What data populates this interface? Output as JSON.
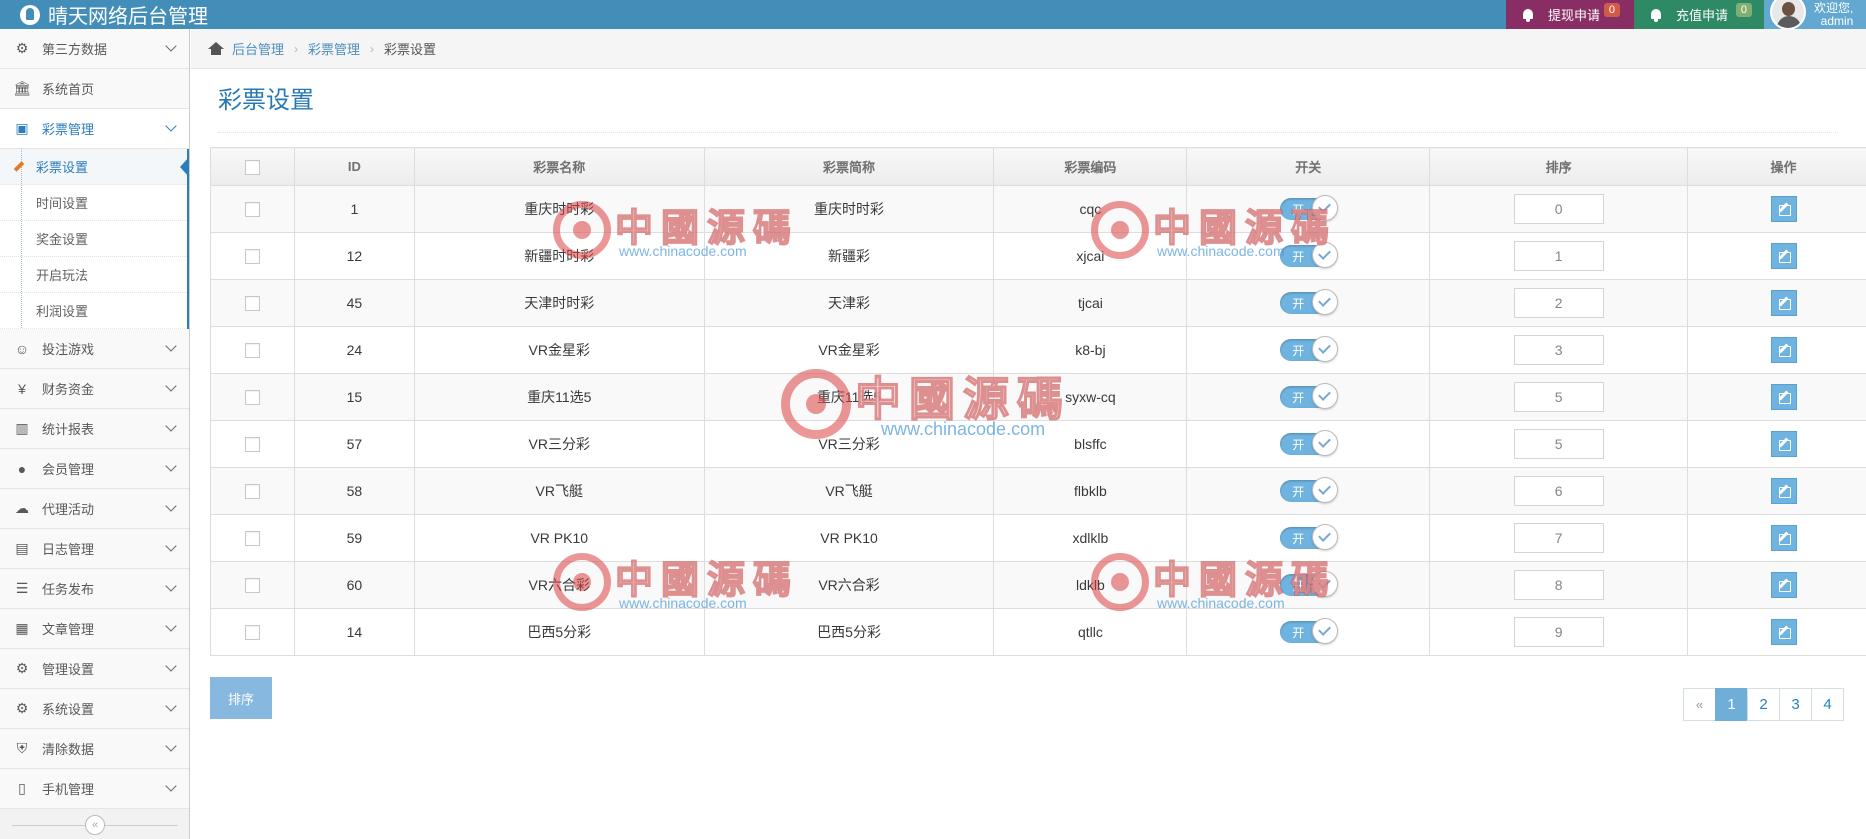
{
  "header": {
    "app_title": "晴天网络后台管理",
    "withdraw_label": "提现申请",
    "withdraw_count": "0",
    "recharge_label": "充值申请",
    "recharge_count": "0",
    "welcome": "欢迎您,",
    "username": "admin"
  },
  "sidebar": {
    "items": [
      {
        "label": "第三方数据",
        "icon": "gear-icon"
      },
      {
        "label": "系统首页",
        "icon": "bank-icon"
      },
      {
        "label": "彩票管理",
        "icon": "money-icon"
      },
      {
        "label": "投注游戏",
        "icon": "reddit-icon"
      },
      {
        "label": "财务资金",
        "icon": "yen-icon"
      },
      {
        "label": "统计报表",
        "icon": "bar-chart-icon"
      },
      {
        "label": "会员管理",
        "icon": "users-icon"
      },
      {
        "label": "代理活动",
        "icon": "cloud-icon"
      },
      {
        "label": "日志管理",
        "icon": "file-icon"
      },
      {
        "label": "任务发布",
        "icon": "tasks-icon"
      },
      {
        "label": "文章管理",
        "icon": "document-icon"
      },
      {
        "label": "管理设置",
        "icon": "gear-icon"
      },
      {
        "label": "系统设置",
        "icon": "gears-icon"
      },
      {
        "label": "清除数据",
        "icon": "shield-icon"
      },
      {
        "label": "手机管理",
        "icon": "mobile-icon"
      }
    ],
    "submenu": [
      "彩票设置",
      "时间设置",
      "奖金设置",
      "开启玩法",
      "利润设置"
    ],
    "collapse_glyph": "«"
  },
  "breadcrumb": {
    "home": "后台管理",
    "section": "彩票管理",
    "current": "彩票设置",
    "sep": "›"
  },
  "page": {
    "title": "彩票设置",
    "sort_button": "排序"
  },
  "table": {
    "headers": [
      "ID",
      "彩票名称",
      "彩票简称",
      "彩票编码",
      "开关",
      "排序",
      "操作"
    ],
    "toggle_label": "开",
    "rows": [
      {
        "id": "1",
        "name": "重庆时时彩",
        "short": "重庆时时彩",
        "code": "cqc",
        "sort": "0"
      },
      {
        "id": "12",
        "name": "新疆时时彩",
        "short": "新疆彩",
        "code": "xjcai",
        "sort": "1"
      },
      {
        "id": "45",
        "name": "天津时时彩",
        "short": "天津彩",
        "code": "tjcai",
        "sort": "2"
      },
      {
        "id": "24",
        "name": "VR金星彩",
        "short": "VR金星彩",
        "code": "k8-bj",
        "sort": "3"
      },
      {
        "id": "15",
        "name": "重庆11选5",
        "short": "重庆11选5",
        "code": "syxw-cq",
        "sort": "5"
      },
      {
        "id": "57",
        "name": "VR三分彩",
        "short": "VR三分彩",
        "code": "blsffc",
        "sort": "5"
      },
      {
        "id": "58",
        "name": "VR飞艇",
        "short": "VR飞艇",
        "code": "flbklb",
        "sort": "6"
      },
      {
        "id": "59",
        "name": "VR PK10",
        "short": "VR PK10",
        "code": "xdlklb",
        "sort": "7"
      },
      {
        "id": "60",
        "name": "VR六合彩",
        "short": "VR六合彩",
        "code": "ldklb",
        "sort": "8"
      },
      {
        "id": "14",
        "name": "巴西5分彩",
        "short": "巴西5分彩",
        "code": "qtllc",
        "sort": "9"
      }
    ]
  },
  "pagination": {
    "prev": "«",
    "pages": [
      "1",
      "2",
      "3",
      "4"
    ],
    "active": "1"
  },
  "watermark": {
    "text": "中國源碼",
    "url": "www.chinacode.com"
  },
  "colors": {
    "navbar": "#438eb9",
    "withdraw": "#892e65",
    "recharge": "#2e8965",
    "accent": "#2b7dbc",
    "toggle": "#6fb3e0"
  }
}
